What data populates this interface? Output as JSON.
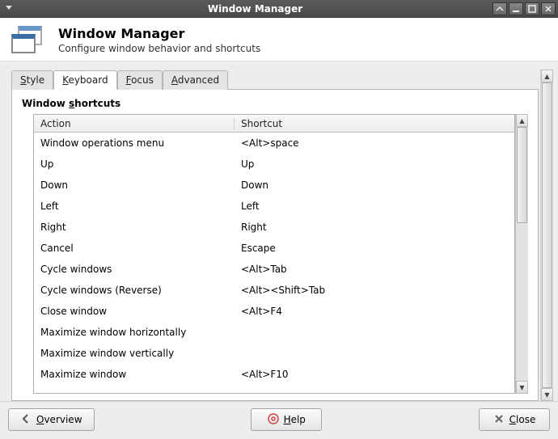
{
  "titlebar": {
    "title": "Window Manager"
  },
  "header": {
    "title": "Window Manager",
    "subtitle": "Configure window behavior and shortcuts"
  },
  "tabs": [
    {
      "label": "Style",
      "accel": "S"
    },
    {
      "label": "Keyboard",
      "accel": "K"
    },
    {
      "label": "Focus",
      "accel": "F"
    },
    {
      "label": "Advanced",
      "accel": "A"
    }
  ],
  "active_tab": 1,
  "section": {
    "title": "Window shortcuts",
    "accel": "s"
  },
  "columns": {
    "action": "Action",
    "shortcut": "Shortcut"
  },
  "shortcuts": [
    {
      "action": "Window operations menu",
      "shortcut": "<Alt>space"
    },
    {
      "action": "Up",
      "shortcut": "Up"
    },
    {
      "action": "Down",
      "shortcut": "Down"
    },
    {
      "action": "Left",
      "shortcut": "Left"
    },
    {
      "action": "Right",
      "shortcut": "Right"
    },
    {
      "action": "Cancel",
      "shortcut": "Escape"
    },
    {
      "action": "Cycle windows",
      "shortcut": "<Alt>Tab"
    },
    {
      "action": "Cycle windows (Reverse)",
      "shortcut": "<Alt><Shift>Tab"
    },
    {
      "action": "Close window",
      "shortcut": "<Alt>F4"
    },
    {
      "action": "Maximize window horizontally",
      "shortcut": ""
    },
    {
      "action": "Maximize window vertically",
      "shortcut": ""
    },
    {
      "action": "Maximize window",
      "shortcut": "<Alt>F10"
    }
  ],
  "footer": {
    "overview": "Overview",
    "help": "Help",
    "close": "Close"
  }
}
